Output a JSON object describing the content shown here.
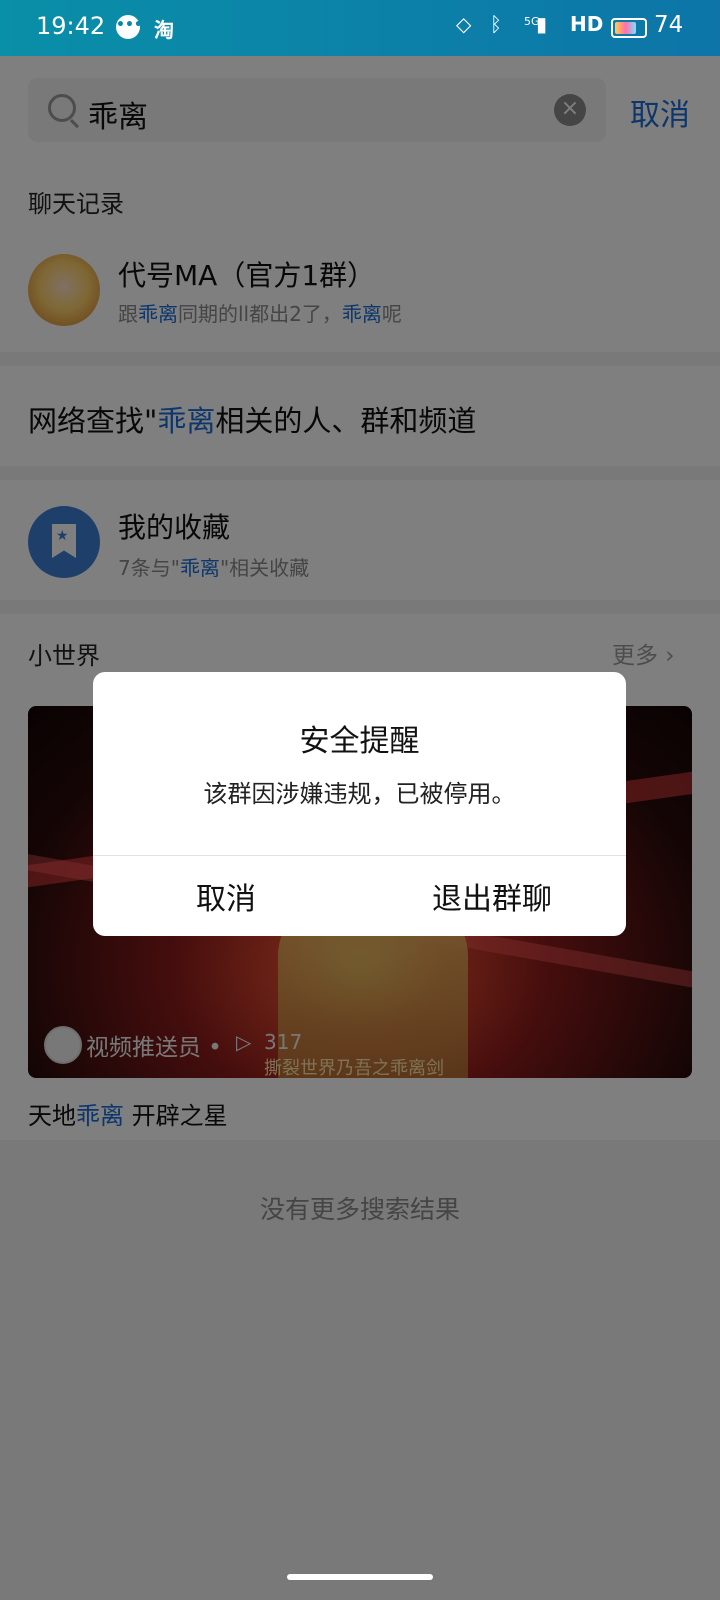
{
  "status_bar": {
    "time": "19:42",
    "taobao": "淘",
    "network": "5G",
    "hd": "HD",
    "battery": "74",
    "battery_level": 0.74
  },
  "search": {
    "query": "乖离",
    "cancel_label": "取消"
  },
  "chat_records": {
    "section_label": "聊天记录",
    "item": {
      "name": "代号MA（官方1群）",
      "snippet_p1": "跟",
      "snippet_hl1": "乖离",
      "snippet_p2": "同期的ll都出2了，",
      "snippet_hl2": "乖离",
      "snippet_p3": "呢"
    }
  },
  "network_search": {
    "prefix": "网络查找\"",
    "highlight": "乖离",
    "suffix": "相关的人、群和频道"
  },
  "favorites": {
    "title": "我的收藏",
    "sub_prefix": "7条与\"",
    "sub_hl": "乖离",
    "sub_suffix": "\"相关收藏"
  },
  "small_world": {
    "section_label": "小世界",
    "more_label": "更多",
    "video": {
      "uploader": "视频推送员 •",
      "views": "317",
      "caption": "撕裂世界乃吾之乖离剑"
    },
    "title_p1": "天地",
    "title_hl": "乖离",
    "title_p2": " 开辟之星"
  },
  "no_more_results": "没有更多搜索结果",
  "dialog": {
    "title": "安全提醒",
    "message": "该群因涉嫌违规，已被停用。",
    "cancel_label": "取消",
    "exit_label": "退出群聊"
  },
  "colors": {
    "accent": "#1a6dd8",
    "status_bar": "#0a86a8"
  }
}
